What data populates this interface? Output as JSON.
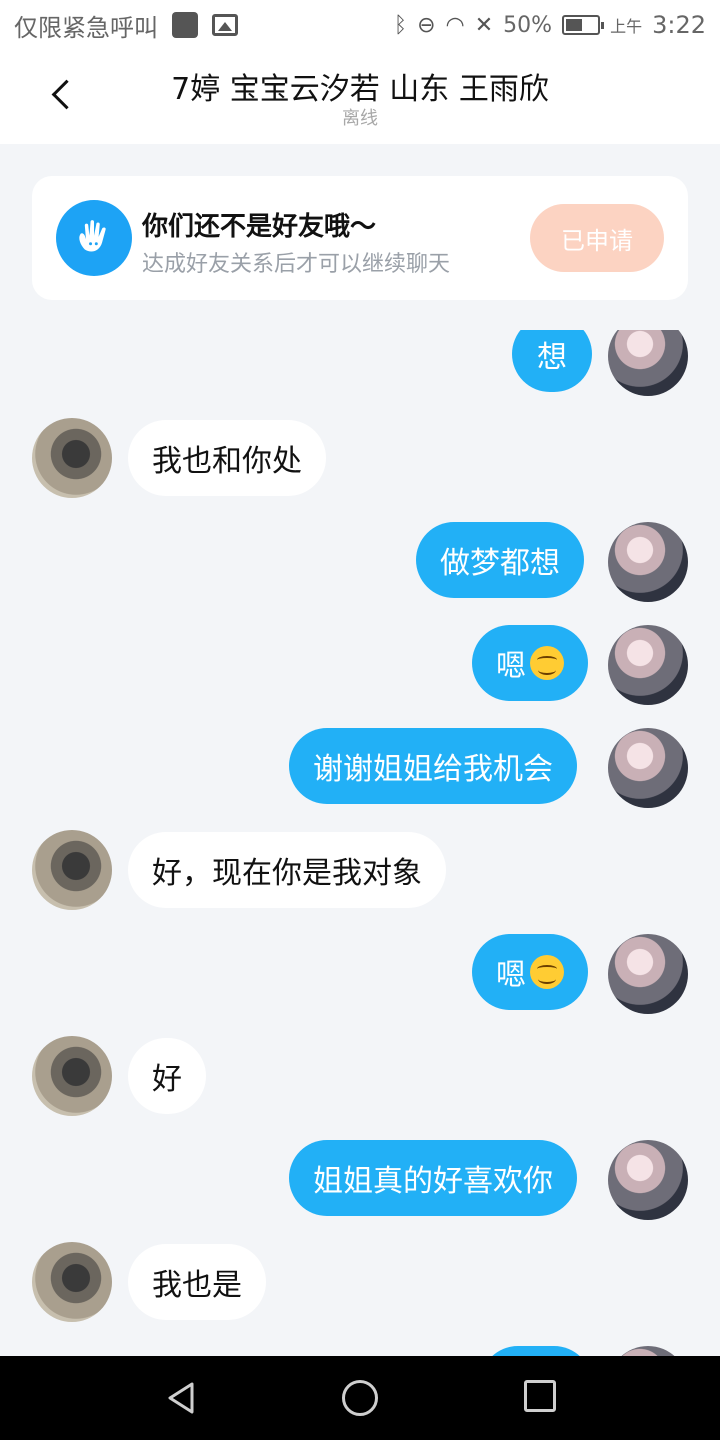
{
  "status_bar": {
    "carrier_text": "仅限紧急呼叫",
    "battery": "50%",
    "time_prefix": "上午",
    "time": "3:22"
  },
  "header": {
    "title": "7婷 宝宝云汐若 山东 王雨欣",
    "status": "离线"
  },
  "friend_card": {
    "title": "你们还不是好友哦～",
    "subtitle": "达成好友关系后才可以继续聊天",
    "button_label": "已申请"
  },
  "messages": [
    {
      "side": "me",
      "text": "想"
    },
    {
      "side": "other",
      "text": "我也和你处"
    },
    {
      "side": "me",
      "text": "做梦都想"
    },
    {
      "side": "me",
      "text": "嗯",
      "emoji": "smiling-face"
    },
    {
      "side": "me",
      "text": "谢谢姐姐给我机会"
    },
    {
      "side": "other",
      "text": "好，现在你是我对象"
    },
    {
      "side": "me",
      "text": "嗯",
      "emoji": "smiling-face"
    },
    {
      "side": "other",
      "text": "好"
    },
    {
      "side": "me",
      "text": "姐姐真的好喜欢你"
    },
    {
      "side": "other",
      "text": "我也是"
    }
  ]
}
